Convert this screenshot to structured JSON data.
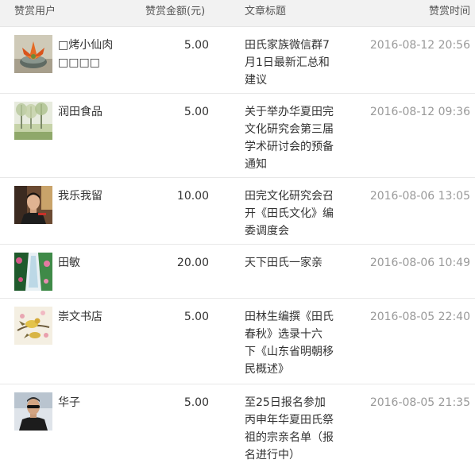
{
  "columns": {
    "user": "赞赏用户",
    "amount": "赞赏金额(元)",
    "title": "文章标题",
    "time": "赞赏时间"
  },
  "rows": [
    {
      "avatar_icon": "flower-bowl-avatar",
      "user": "□烤小仙肉□□□□",
      "amount": "5.00",
      "title": "田氏家族微信群7月1日最新汇总和建议",
      "time": "2016-08-12 20:56"
    },
    {
      "avatar_icon": "misty-trees-avatar",
      "user": "润田食品",
      "amount": "5.00",
      "title": "关于举办华夏田完文化研究会第三届学术研讨会的预备通知",
      "time": "2016-08-12 09:36"
    },
    {
      "avatar_icon": "man-portrait-avatar",
      "user": "我乐我留",
      "amount": "10.00",
      "title": "田完文化研究会召开《田氏文化》编委调度会",
      "time": "2016-08-06 13:05"
    },
    {
      "avatar_icon": "waterfall-avatar",
      "user": "田敏",
      "amount": "20.00",
      "title": "天下田氏一家亲",
      "time": "2016-08-06 10:49"
    },
    {
      "avatar_icon": "bird-painting-avatar",
      "user": "崇文书店",
      "amount": "5.00",
      "title": "田林生编撰《田氏春秋》选录十六 下《山东省明朝移民概述》",
      "time": "2016-08-05 22:40"
    },
    {
      "avatar_icon": "man-sunglasses-avatar",
      "user": "华子",
      "amount": "5.00",
      "title": "至25日报名参加丙申年华夏田氏祭祖的宗亲名单（报名进行中）",
      "time": "2016-08-05 21:35"
    }
  ]
}
